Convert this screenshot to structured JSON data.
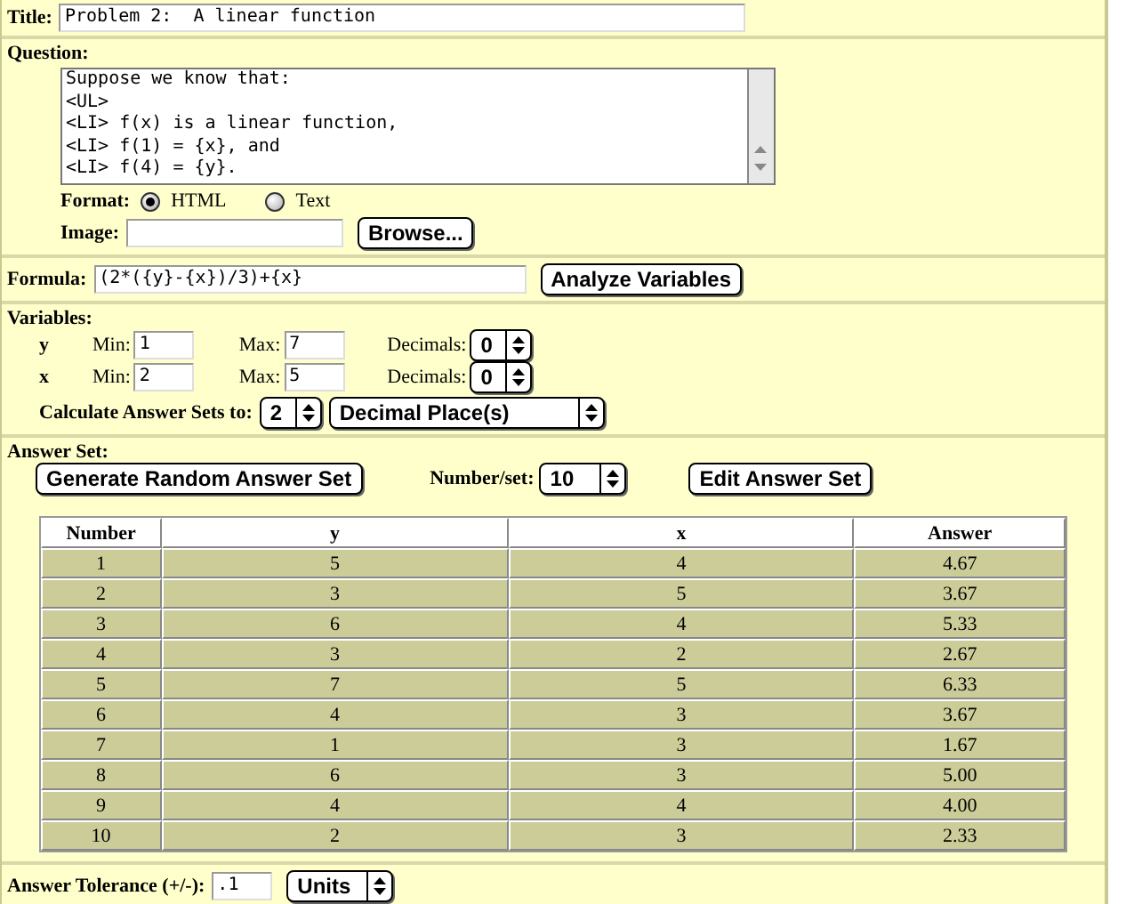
{
  "title": {
    "label": "Title:",
    "value": "Problem 2:  A linear function"
  },
  "question": {
    "label": "Question:",
    "text": "Suppose we know that:\n<UL>\n<LI> f(x) is a linear function,\n<LI> f(1) = {x}, and\n<LI> f(4) = {y}.",
    "format_label": "Format:",
    "formats": [
      {
        "label": "HTML",
        "selected": true
      },
      {
        "label": "Text",
        "selected": false
      }
    ],
    "image_label": "Image:",
    "browse_button": "Browse..."
  },
  "formula": {
    "label": "Formula:",
    "value": "(2*({y}-{x})/3)+{x}",
    "button": "Analyze Variables"
  },
  "variables": {
    "label": "Variables:",
    "rows": [
      {
        "name": "y",
        "min_label": "Min:",
        "min": "1",
        "max_label": "Max:",
        "max": "7",
        "decimals_label": "Decimals:",
        "decimals": "0"
      },
      {
        "name": "x",
        "min_label": "Min:",
        "min": "2",
        "max_label": "Max:",
        "max": "5",
        "decimals_label": "Decimals:",
        "decimals": "0"
      }
    ],
    "calc_label": "Calculate Answer Sets to:",
    "calc_value": "2",
    "calc_unit": "Decimal Place(s)"
  },
  "answer_set": {
    "label": "Answer Set:",
    "generate_button": "Generate Random Answer Set",
    "number_label": "Number/set:",
    "number_value": "10",
    "edit_button": "Edit Answer Set",
    "table": {
      "columns": [
        "Number",
        "y",
        "x",
        "Answer"
      ],
      "rows": [
        [
          "1",
          "5",
          "4",
          "4.67"
        ],
        [
          "2",
          "3",
          "5",
          "3.67"
        ],
        [
          "3",
          "6",
          "4",
          "5.33"
        ],
        [
          "4",
          "3",
          "2",
          "2.67"
        ],
        [
          "5",
          "7",
          "5",
          "6.33"
        ],
        [
          "6",
          "4",
          "3",
          "3.67"
        ],
        [
          "7",
          "1",
          "3",
          "1.67"
        ],
        [
          "8",
          "6",
          "3",
          "5.00"
        ],
        [
          "9",
          "4",
          "4",
          "4.00"
        ],
        [
          "10",
          "2",
          "3",
          "2.33"
        ]
      ]
    }
  },
  "tolerance": {
    "label": "Answer Tolerance (+/-):",
    "value": ".1",
    "unit": "Units"
  }
}
